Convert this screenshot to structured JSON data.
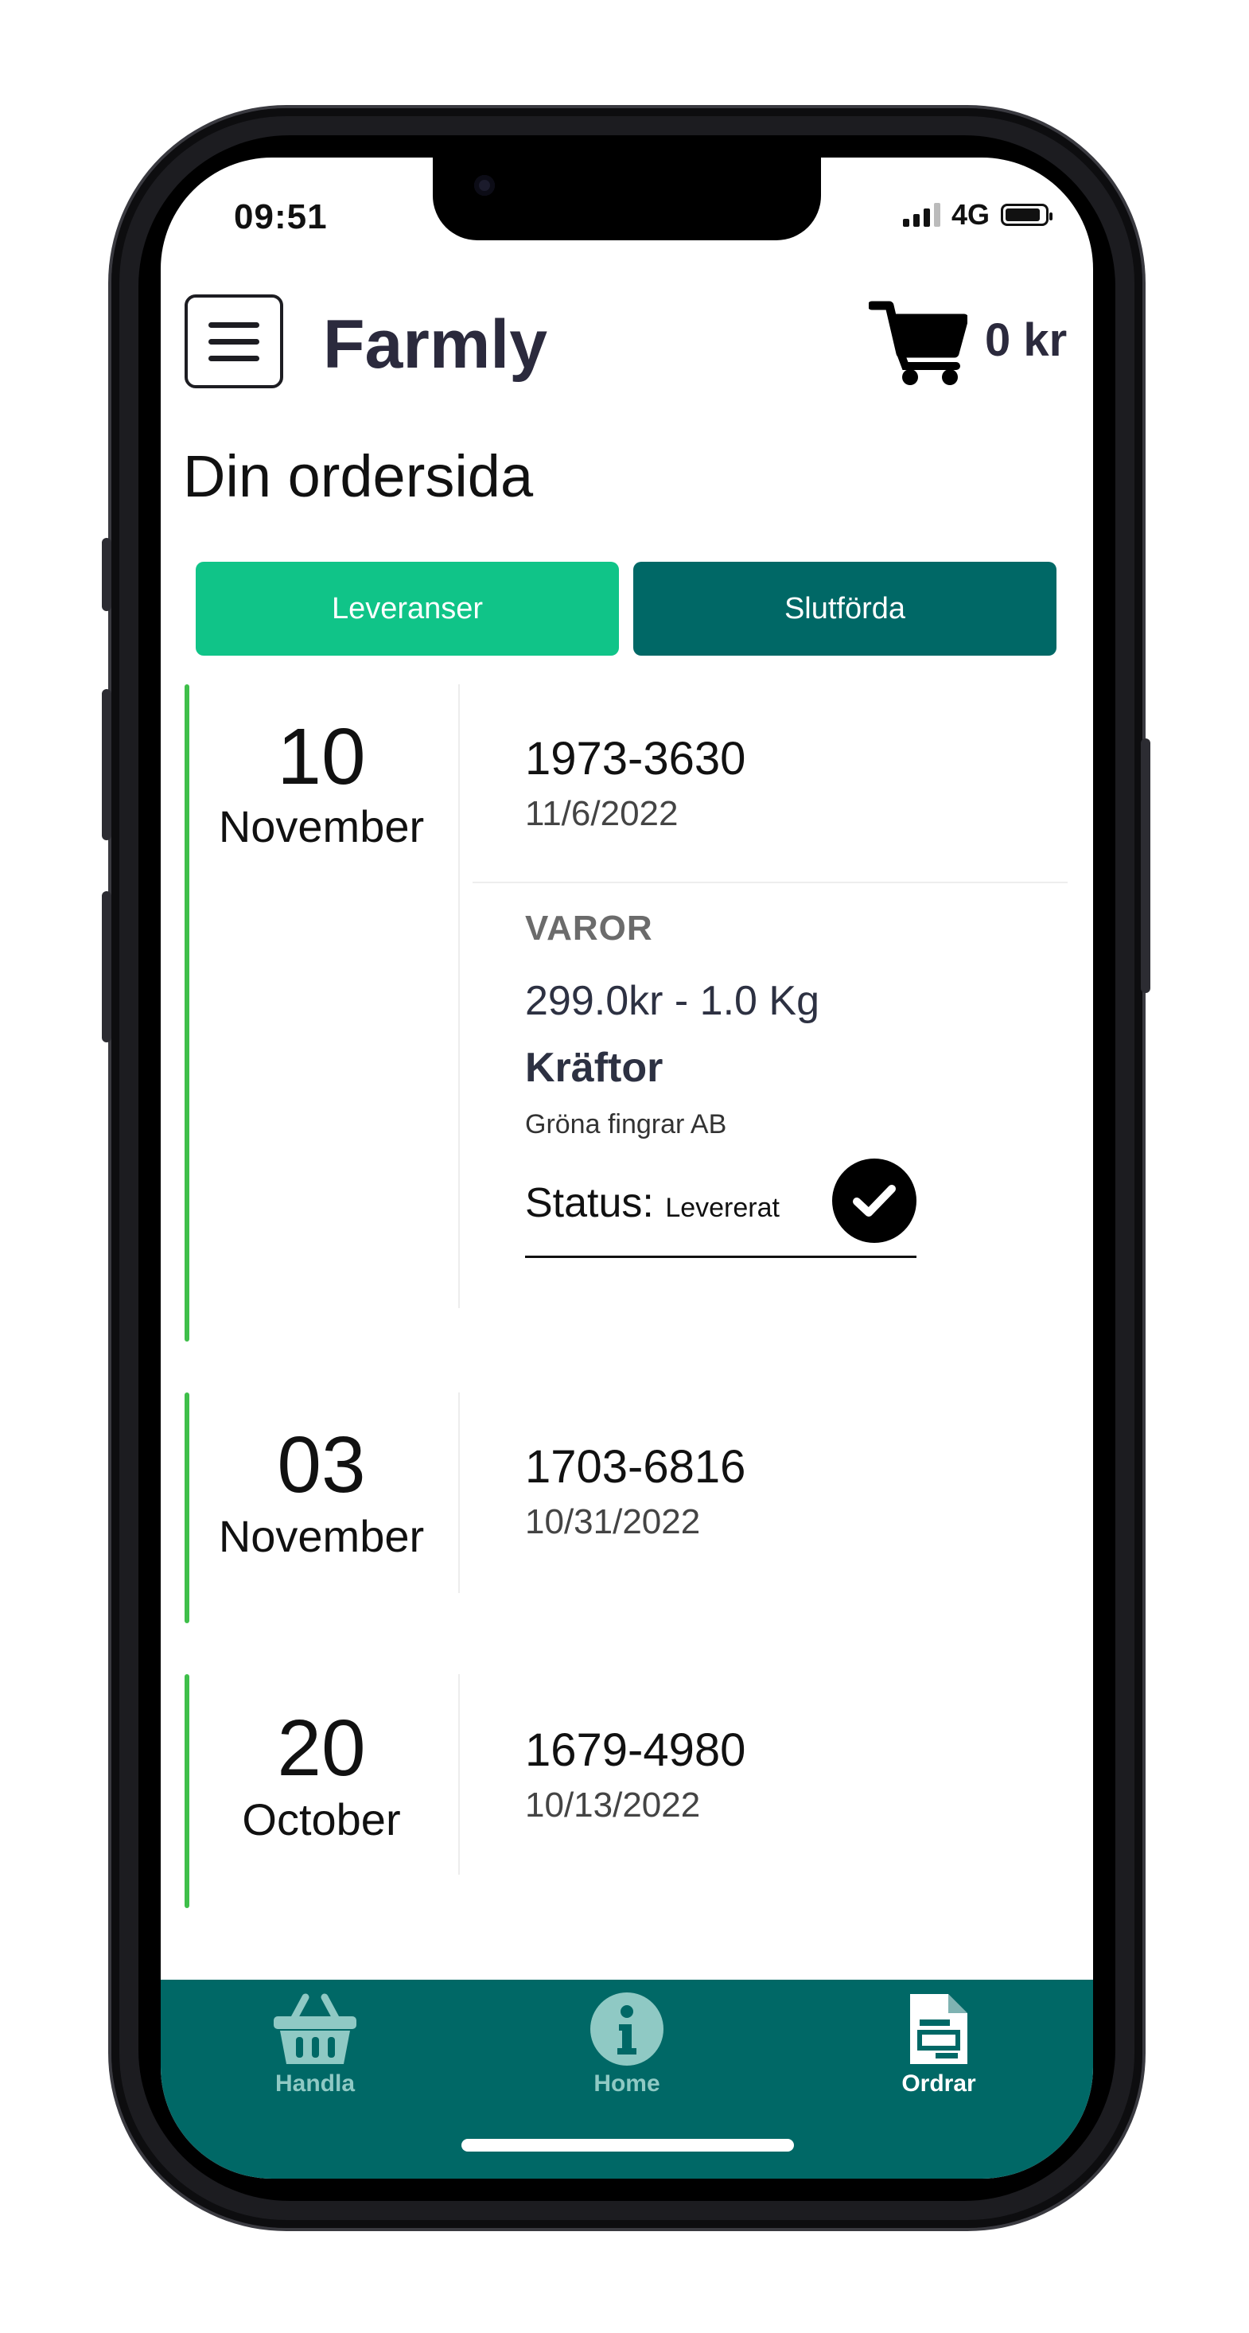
{
  "colors": {
    "tab_active_bg": "#10c488",
    "tab_inactive_bg": "#006866",
    "timeline_bar": "#3fbf4a",
    "nav_bg": "#006866",
    "nav_inactive": "#8fc9c4",
    "nav_active": "#ffffff"
  },
  "status_bar": {
    "time": "09:51",
    "network": "4G",
    "battery_level": 0.9
  },
  "header": {
    "menu_icon": "hamburger-menu-icon",
    "title": "Farmly",
    "cart_icon": "shopping-cart-icon",
    "cart_total": "0 kr"
  },
  "page": {
    "title": "Din ordersida"
  },
  "tabs": [
    {
      "label": "Leveranser",
      "active": true
    },
    {
      "label": "Slutförda",
      "active": false
    }
  ],
  "orders": [
    {
      "day": "10",
      "month": "November",
      "number": "1973-3630",
      "date": "11/6/2022",
      "expanded": true,
      "items_heading": "VAROR",
      "item": {
        "price_weight": "299.0kr - 1.0 Kg",
        "name": "Kräftor",
        "seller": "Gröna fingrar AB",
        "status_label": "Status:",
        "status_value": "Levererat",
        "status_icon": "checkmark-circle-icon"
      }
    },
    {
      "day": "03",
      "month": "November",
      "number": "1703-6816",
      "date": "10/31/2022",
      "expanded": false
    },
    {
      "day": "20",
      "month": "October",
      "number": "1679-4980",
      "date": "10/13/2022",
      "expanded": false
    }
  ],
  "bottom_nav": [
    {
      "label": "Handla",
      "icon": "basket-icon",
      "active": false
    },
    {
      "label": "Home",
      "icon": "info-circle-icon",
      "active": false
    },
    {
      "label": "Ordrar",
      "icon": "document-icon",
      "active": true
    }
  ]
}
